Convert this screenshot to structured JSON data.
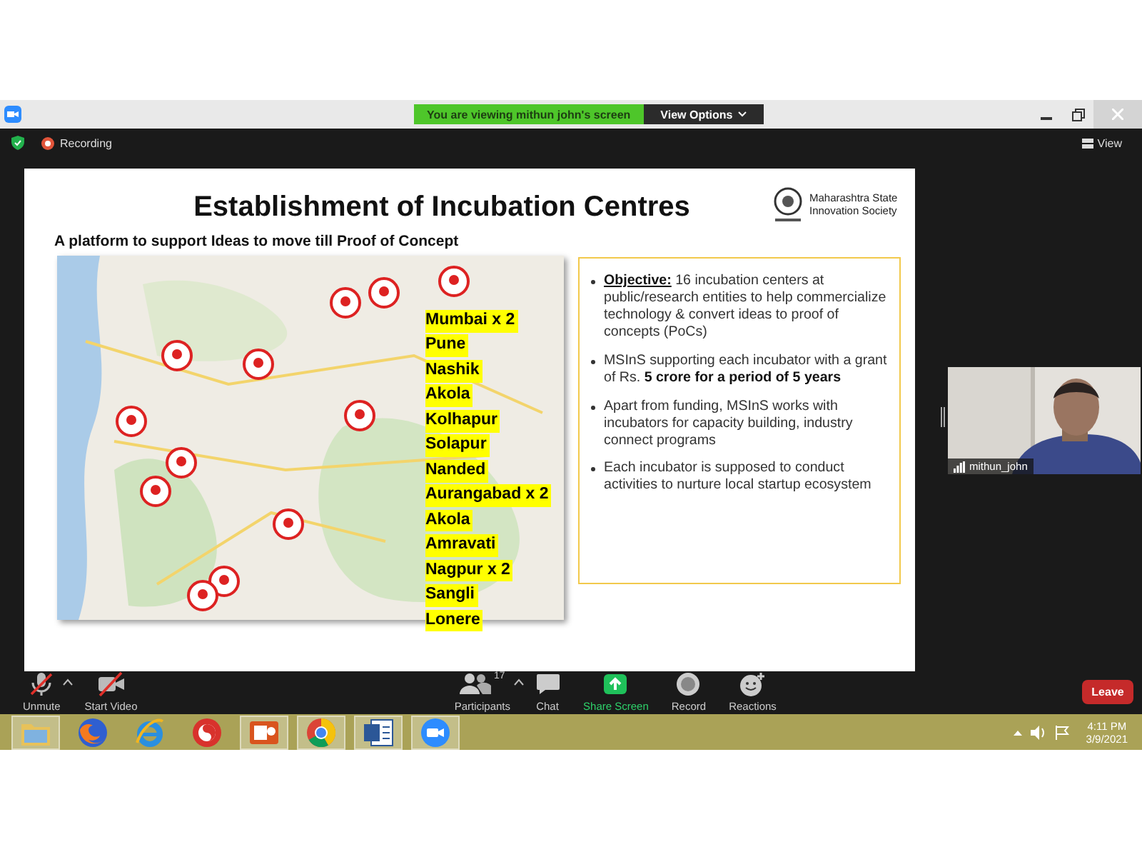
{
  "title_bar": {
    "banner": "You are viewing mithun john's screen",
    "view_options": "View Options"
  },
  "meeting_bar": {
    "recording": "Recording",
    "view": "View"
  },
  "slide": {
    "title": "Establishment of Incubation Centres",
    "org": "Maharashtra State Innovation Society",
    "subtitle": "A platform to support Ideas to move till Proof of Concept",
    "cities": [
      "Mumbai x 2",
      "Pune",
      "Nashik",
      "Akola",
      "Kolhapur",
      "Solapur",
      "Nanded",
      "Aurangabad x 2",
      "Akola",
      "Amravati",
      "Nagpur x 2",
      "Sangli",
      "Lonere"
    ],
    "bullets": [
      {
        "lead": "Objective:",
        "text": "16 incubation centers at public/research entities to help commercialize technology & convert ideas to proof of concepts (PoCs)"
      },
      {
        "text": "MSInS supporting each incubator with a grant of Rs. **5 crore for a period of 5 years**"
      },
      {
        "text": "Apart from funding, MSInS works with incubators for capacity building, industry connect programs"
      },
      {
        "text": "Each incubator is supposed to conduct activities to nurture local startup ecosystem"
      }
    ]
  },
  "video": {
    "name": "mithun_john"
  },
  "toolbar": [
    {
      "kind": "mic-off",
      "label": "Unmute",
      "menu": true
    },
    {
      "kind": "video-off",
      "label": "Start Video",
      "menu": false
    },
    {
      "kind": "participants",
      "label": "Participants",
      "count": "17",
      "menu": true
    },
    {
      "kind": "chat",
      "label": "Chat",
      "menu": false
    },
    {
      "kind": "share",
      "label": "Share Screen",
      "menu": false
    },
    {
      "kind": "record",
      "label": "Record",
      "menu": false
    },
    {
      "kind": "reactions",
      "label": "Reactions",
      "menu": false
    }
  ],
  "leave": "Leave",
  "taskbar": {
    "apps": [
      {
        "kind": "folder",
        "open": true
      },
      {
        "kind": "fox",
        "open": false
      },
      {
        "kind": "e-globe",
        "open": false
      },
      {
        "kind": "swirl",
        "open": false
      },
      {
        "kind": "slides",
        "open": true
      },
      {
        "kind": "wheel",
        "open": true
      },
      {
        "kind": "document",
        "open": true
      },
      {
        "kind": "camera",
        "open": true
      }
    ],
    "time": "4:11 PM",
    "date": "3/9/2021"
  }
}
